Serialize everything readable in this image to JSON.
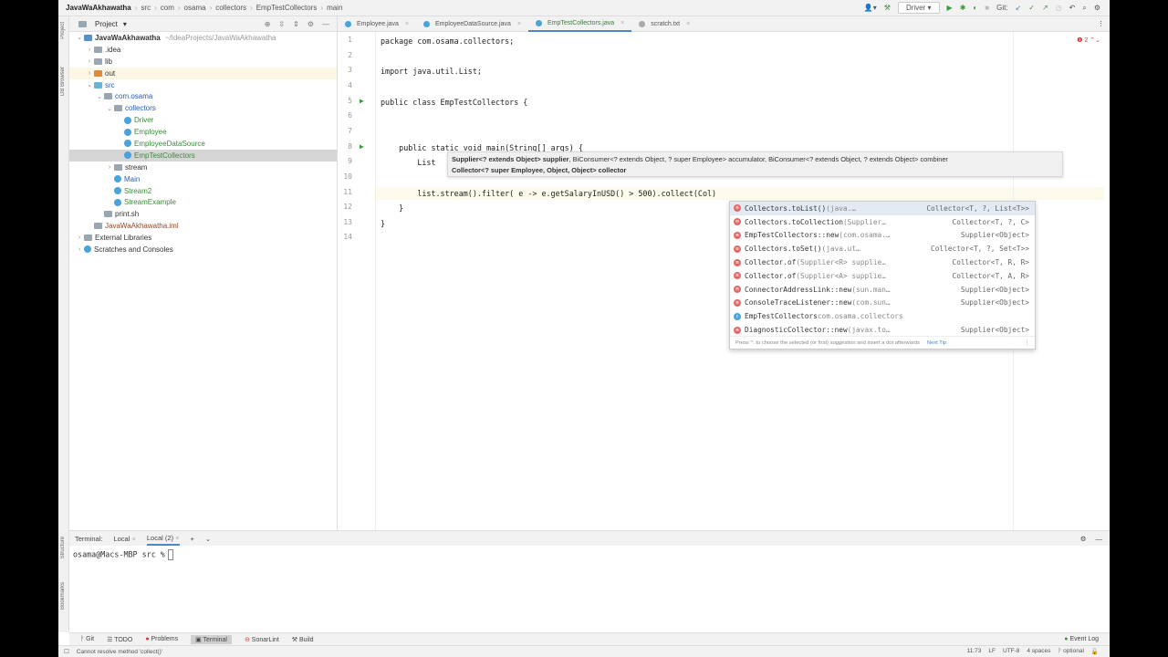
{
  "breadcrumb": {
    "project": "JavaWaAkhawatha",
    "items": [
      "src",
      "com",
      "osama",
      "collectors",
      "EmpTestCollectors",
      "main"
    ]
  },
  "toolbar": {
    "run_config": "Driver",
    "git_label": "Git:"
  },
  "side_tools": {
    "left": [
      "Project",
      "DB Browser"
    ],
    "bottom_left": [
      "Structure",
      "Bookmarks"
    ]
  },
  "project": {
    "title": "Project",
    "tree": [
      {
        "label": "JavaWaAkhawatha",
        "suffix": "~/IdeaProjects/JavaWaAkhawatha",
        "depth": 0,
        "arrow": "v",
        "kind": "module"
      },
      {
        "label": ".idea",
        "depth": 1,
        "arrow": ">",
        "kind": "folder"
      },
      {
        "label": "lib",
        "depth": 1,
        "arrow": ">",
        "kind": "folder"
      },
      {
        "label": "out",
        "depth": 1,
        "arrow": ">",
        "kind": "folder-out"
      },
      {
        "label": "src",
        "depth": 1,
        "arrow": "v",
        "kind": "folder-src"
      },
      {
        "label": "com.osama",
        "depth": 2,
        "arrow": "v",
        "kind": "package"
      },
      {
        "label": "collectors",
        "depth": 3,
        "arrow": "v",
        "kind": "package"
      },
      {
        "label": "Driver",
        "depth": 4,
        "kind": "class"
      },
      {
        "label": "Employee",
        "depth": 4,
        "kind": "class"
      },
      {
        "label": "EmployeeDataSource",
        "depth": 4,
        "kind": "class"
      },
      {
        "label": "EmpTestCollectors",
        "depth": 4,
        "kind": "class",
        "selected": true
      },
      {
        "label": "stream",
        "depth": 3,
        "arrow": ">",
        "kind": "package"
      },
      {
        "label": "Main",
        "depth": 3,
        "kind": "class-main"
      },
      {
        "label": "Stream2",
        "depth": 3,
        "kind": "class"
      },
      {
        "label": "StreamExample",
        "depth": 3,
        "kind": "class"
      },
      {
        "label": "print.sh",
        "depth": 2,
        "kind": "file"
      },
      {
        "label": "JavaWaAkhawatha.iml",
        "depth": 1,
        "kind": "iml"
      },
      {
        "label": "External Libraries",
        "depth": 0,
        "arrow": ">",
        "kind": "lib"
      },
      {
        "label": "Scratches and Consoles",
        "depth": 0,
        "arrow": ">",
        "kind": "scratch"
      }
    ]
  },
  "tabs": [
    {
      "label": "Employee.java"
    },
    {
      "label": "EmployeeDataSource.java"
    },
    {
      "label": "EmpTestCollectors.java",
      "active": true
    },
    {
      "label": "scratch.txt"
    }
  ],
  "editor": {
    "error_count": "2",
    "lines": [
      {
        "n": "1",
        "code": "package com.osama.collectors;"
      },
      {
        "n": "2",
        "code": ""
      },
      {
        "n": "3",
        "code": "import java.util.List;"
      },
      {
        "n": "4",
        "code": ""
      },
      {
        "n": "5",
        "code": "public class EmpTestCollectors {"
      },
      {
        "n": "6",
        "code": ""
      },
      {
        "n": "7",
        "code": ""
      },
      {
        "n": "8",
        "code": "    public static void main(String[] args) {"
      },
      {
        "n": "9",
        "code": "        List"
      },
      {
        "n": "10",
        "code": ""
      },
      {
        "n": "11",
        "code": "        list.stream().filter( e -> e.getSalaryInUSD() > 500).collect(Col)"
      },
      {
        "n": "12",
        "code": "    }"
      },
      {
        "n": "13",
        "code": "}"
      },
      {
        "n": "14",
        "code": ""
      }
    ]
  },
  "param_hint": {
    "line1_bold": "Supplier<? extends Object> supplier",
    "line1_rest": ", BiConsumer<? extends Object, ? super Employee> accumulator, BiConsumer<? extends Object, ? extends Object> combiner",
    "line2": "Collector<? super Employee, Object, Object> collector"
  },
  "completion": {
    "items": [
      {
        "name": "Collectors.toList()",
        "detail": " (java.…",
        "type": "Collector<T, ?, List<T>>",
        "kind": "m"
      },
      {
        "name": "Collectors.toCollection",
        "detail": "(Supplier…",
        "type": "Collector<T, ?, C>",
        "kind": "m"
      },
      {
        "name": "EmpTestCollectors::new",
        "detail": " (com.osama.…",
        "type": "Supplier<Object>",
        "kind": "m"
      },
      {
        "name": "Collectors.toSet()",
        "detail": " (java.ut…",
        "type": "Collector<T, ?, Set<T>>",
        "kind": "m"
      },
      {
        "name": "Collector.of",
        "detail": "(Supplier<R> supplie…",
        "type": "Collector<T, R, R>",
        "kind": "m"
      },
      {
        "name": "Collector.of",
        "detail": "(Supplier<A> supplie…",
        "type": "Collector<T, A, R>",
        "kind": "m"
      },
      {
        "name": "ConnectorAddressLink::new",
        "detail": " (sun.man…",
        "type": "Supplier<Object>",
        "kind": "m"
      },
      {
        "name": "ConsoleTraceListener::new",
        "detail": " (com.sun…",
        "type": "Supplier<Object>",
        "kind": "m"
      },
      {
        "name": "EmpTestCollectors",
        "detail": " com.osama.collectors",
        "type": "",
        "kind": "c"
      },
      {
        "name": "DiagnosticCollector::new",
        "detail": " (javax.to…",
        "type": "Supplier<Object>",
        "kind": "m"
      }
    ],
    "footer": "Press ^. to choose the selected (or first) suggestion and insert a dot afterwards",
    "next_tip": "Next Tip"
  },
  "terminal": {
    "label": "Terminal:",
    "tabs": [
      "Local",
      "Local (2)"
    ],
    "prompt": "osama@Macs-MBP src %"
  },
  "bottom_tools": [
    "Git",
    "TODO",
    "Problems",
    "Terminal",
    "SonarLint",
    "Build"
  ],
  "event_log": "Event Log",
  "status": {
    "message": "Cannot resolve method 'collect()'",
    "position": "11:73",
    "line_sep": "LF",
    "encoding": "UTF-8",
    "indent": "4 spaces",
    "branch": "optional"
  }
}
